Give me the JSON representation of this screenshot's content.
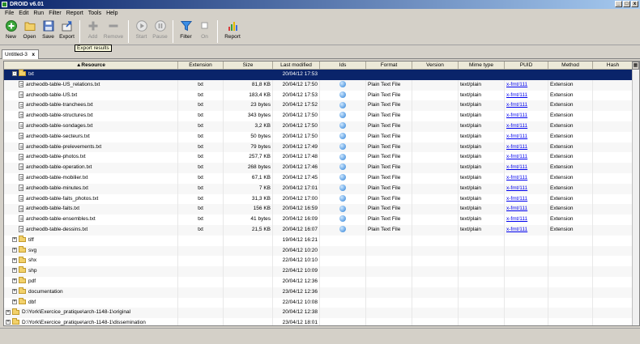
{
  "window": {
    "title": "DROID v6.01",
    "controls": [
      "_",
      "□",
      "x"
    ]
  },
  "menu": [
    "File",
    "Edit",
    "Run",
    "Filter",
    "Report",
    "Tools",
    "Help"
  ],
  "toolbar": {
    "new": "New",
    "open": "Open",
    "save": "Save",
    "export": "Export",
    "add": "Add",
    "remove": "Remove",
    "start": "Start",
    "pause": "Pause",
    "filter": "Filter",
    "on": "On",
    "report": "Report"
  },
  "tooltip": "Export results",
  "tab": {
    "label": "Untitled-3",
    "close": "x"
  },
  "columns": {
    "resource": "▲Resource",
    "extension": "Extension",
    "size": "Size",
    "last_modified": "Last modified",
    "ids": "Ids",
    "format": "Format",
    "version": "Version",
    "mime": "Mime type",
    "puid": "PUID",
    "method": "Method",
    "hash": "Hash"
  },
  "rows": [
    {
      "name": "txt",
      "kind": "folder",
      "indent": 1,
      "toggle": "-",
      "ext": "",
      "size": "",
      "modified": "20/04/12 17:53",
      "ids": false,
      "format": "",
      "mime": "",
      "puid": "",
      "method": "",
      "selected": true
    },
    {
      "name": "archeodb-table-US_relations.txt",
      "kind": "file",
      "indent": 2,
      "ext": "txt",
      "size": "81,8 KB",
      "modified": "20/04/12 17:50",
      "ids": true,
      "format": "Plain Text File",
      "mime": "text/plain",
      "puid": "x-fmt/111",
      "method": "Extension"
    },
    {
      "name": "archeodb-table-US.txt",
      "kind": "file",
      "indent": 2,
      "ext": "txt",
      "size": "183,4 KB",
      "modified": "20/04/12 17:53",
      "ids": true,
      "format": "Plain Text File",
      "mime": "text/plain",
      "puid": "x-fmt/111",
      "method": "Extension"
    },
    {
      "name": "archeodb-table-tranchees.txt",
      "kind": "file",
      "indent": 2,
      "ext": "txt",
      "size": "23 bytes",
      "modified": "20/04/12 17:52",
      "ids": true,
      "format": "Plain Text File",
      "mime": "text/plain",
      "puid": "x-fmt/111",
      "method": "Extension"
    },
    {
      "name": "archeodb-table-structures.txt",
      "kind": "file",
      "indent": 2,
      "ext": "txt",
      "size": "343 bytes",
      "modified": "20/04/12 17:50",
      "ids": true,
      "format": "Plain Text File",
      "mime": "text/plain",
      "puid": "x-fmt/111",
      "method": "Extension"
    },
    {
      "name": "archeodb-table-sondages.txt",
      "kind": "file",
      "indent": 2,
      "ext": "txt",
      "size": "3,2 KB",
      "modified": "20/04/12 17:50",
      "ids": true,
      "format": "Plain Text File",
      "mime": "text/plain",
      "puid": "x-fmt/111",
      "method": "Extension"
    },
    {
      "name": "archeodb-table-secteurs.txt",
      "kind": "file",
      "indent": 2,
      "ext": "txt",
      "size": "50 bytes",
      "modified": "20/04/12 17:50",
      "ids": true,
      "format": "Plain Text File",
      "mime": "text/plain",
      "puid": "x-fmt/111",
      "method": "Extension"
    },
    {
      "name": "archeodb-table-prelevements.txt",
      "kind": "file",
      "indent": 2,
      "ext": "txt",
      "size": "79 bytes",
      "modified": "20/04/12 17:49",
      "ids": true,
      "format": "Plain Text File",
      "mime": "text/plain",
      "puid": "x-fmt/111",
      "method": "Extension"
    },
    {
      "name": "archeodb-table-photos.txt",
      "kind": "file",
      "indent": 2,
      "ext": "txt",
      "size": "257,7 KB",
      "modified": "20/04/12 17:48",
      "ids": true,
      "format": "Plain Text File",
      "mime": "text/plain",
      "puid": "x-fmt/111",
      "method": "Extension"
    },
    {
      "name": "archeodb-table-operation.txt",
      "kind": "file",
      "indent": 2,
      "ext": "txt",
      "size": "268 bytes",
      "modified": "20/04/12 17:46",
      "ids": true,
      "format": "Plain Text File",
      "mime": "text/plain",
      "puid": "x-fmt/111",
      "method": "Extension"
    },
    {
      "name": "archeodb-table-mobilier.txt",
      "kind": "file",
      "indent": 2,
      "ext": "txt",
      "size": "67,1 KB",
      "modified": "20/04/12 17:45",
      "ids": true,
      "format": "Plain Text File",
      "mime": "text/plain",
      "puid": "x-fmt/111",
      "method": "Extension"
    },
    {
      "name": "archeodb-table-minutes.txt",
      "kind": "file",
      "indent": 2,
      "ext": "txt",
      "size": "7 KB",
      "modified": "20/04/12 17:01",
      "ids": true,
      "format": "Plain Text File",
      "mime": "text/plain",
      "puid": "x-fmt/111",
      "method": "Extension"
    },
    {
      "name": "archeodb-table-faits_photos.txt",
      "kind": "file",
      "indent": 2,
      "ext": "txt",
      "size": "31,3 KB",
      "modified": "20/04/12 17:00",
      "ids": true,
      "format": "Plain Text File",
      "mime": "text/plain",
      "puid": "x-fmt/111",
      "method": "Extension"
    },
    {
      "name": "archeodb-table-faits.txt",
      "kind": "file",
      "indent": 2,
      "ext": "txt",
      "size": "156 KB",
      "modified": "20/04/12 16:59",
      "ids": true,
      "format": "Plain Text File",
      "mime": "text/plain",
      "puid": "x-fmt/111",
      "method": "Extension"
    },
    {
      "name": "archeodb-table-ensembles.txt",
      "kind": "file",
      "indent": 2,
      "ext": "txt",
      "size": "41 bytes",
      "modified": "20/04/12 16:09",
      "ids": true,
      "format": "Plain Text File",
      "mime": "text/plain",
      "puid": "x-fmt/111",
      "method": "Extension"
    },
    {
      "name": "archeodb-table-dessins.txt",
      "kind": "file",
      "indent": 2,
      "ext": "txt",
      "size": "21,5 KB",
      "modified": "20/04/12 16:07",
      "ids": true,
      "format": "Plain Text File",
      "mime": "text/plain",
      "puid": "x-fmt/111",
      "method": "Extension"
    },
    {
      "name": "tiff",
      "kind": "folder",
      "indent": 1,
      "toggle": "+",
      "ext": "",
      "size": "",
      "modified": "19/04/12 16:21",
      "ids": false,
      "format": "",
      "mime": "",
      "puid": "",
      "method": ""
    },
    {
      "name": "svg",
      "kind": "folder",
      "indent": 1,
      "toggle": "+",
      "ext": "",
      "size": "",
      "modified": "20/04/12 10:20",
      "ids": false,
      "format": "",
      "mime": "",
      "puid": "",
      "method": ""
    },
    {
      "name": "shx",
      "kind": "folder",
      "indent": 1,
      "toggle": "+",
      "ext": "",
      "size": "",
      "modified": "22/04/12 10:10",
      "ids": false,
      "format": "",
      "mime": "",
      "puid": "",
      "method": ""
    },
    {
      "name": "shp",
      "kind": "folder",
      "indent": 1,
      "toggle": "+",
      "ext": "",
      "size": "",
      "modified": "22/04/12 10:09",
      "ids": false,
      "format": "",
      "mime": "",
      "puid": "",
      "method": ""
    },
    {
      "name": "pdf",
      "kind": "folder",
      "indent": 1,
      "toggle": "+",
      "ext": "",
      "size": "",
      "modified": "20/04/12 12:36",
      "ids": false,
      "format": "",
      "mime": "",
      "puid": "",
      "method": ""
    },
    {
      "name": "documentation",
      "kind": "folder",
      "indent": 1,
      "toggle": "+",
      "ext": "",
      "size": "",
      "modified": "23/04/12 12:36",
      "ids": false,
      "format": "",
      "mime": "",
      "puid": "",
      "method": ""
    },
    {
      "name": "dbf",
      "kind": "folder",
      "indent": 1,
      "toggle": "+",
      "ext": "",
      "size": "",
      "modified": "22/04/12 10:08",
      "ids": false,
      "format": "",
      "mime": "",
      "puid": "",
      "method": ""
    },
    {
      "name": "D:\\York\\Exercice_pratique\\arch-1148-1\\original",
      "kind": "folder",
      "indent": 0,
      "toggle": "+",
      "ext": "",
      "size": "",
      "modified": "20/04/12 12:38",
      "ids": false,
      "format": "",
      "mime": "",
      "puid": "",
      "method": ""
    },
    {
      "name": "D:\\York\\Exercice_pratique\\arch-1148-1\\dissemination",
      "kind": "folder",
      "indent": 0,
      "toggle": "+",
      "ext": "",
      "size": "",
      "modified": "23/04/12 18:01",
      "ids": false,
      "format": "",
      "mime": "",
      "puid": "",
      "method": ""
    }
  ]
}
